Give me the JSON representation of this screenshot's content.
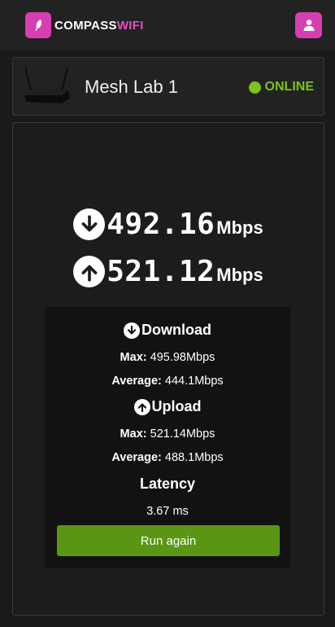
{
  "header": {
    "logo_text_a": "COMPASS",
    "logo_text_b": "WIFI",
    "logo_icon": "feather-icon",
    "user_icon": "user-icon"
  },
  "device": {
    "name": "Mesh Lab 1",
    "status": "ONLINE",
    "status_color": "#7ec21a"
  },
  "speeds": {
    "download_value": "492.16",
    "download_unit": "Mbps",
    "upload_value": "521.12",
    "upload_unit": "Mbps"
  },
  "stats": {
    "download_title": "Download",
    "download_max_label": "Max:",
    "download_max_value": "495.98Mbps",
    "download_avg_label": "Average:",
    "download_avg_value": "444.1Mbps",
    "upload_title": "Upload",
    "upload_max_label": "Max:",
    "upload_max_value": "521.14Mbps",
    "upload_avg_label": "Average:",
    "upload_avg_value": "488.1Mbps",
    "latency_title": "Latency",
    "latency_value": "3.67 ms",
    "run_again_label": "Run again"
  },
  "colors": {
    "brand": "#d63fb2",
    "accent_green": "#5a9614"
  }
}
